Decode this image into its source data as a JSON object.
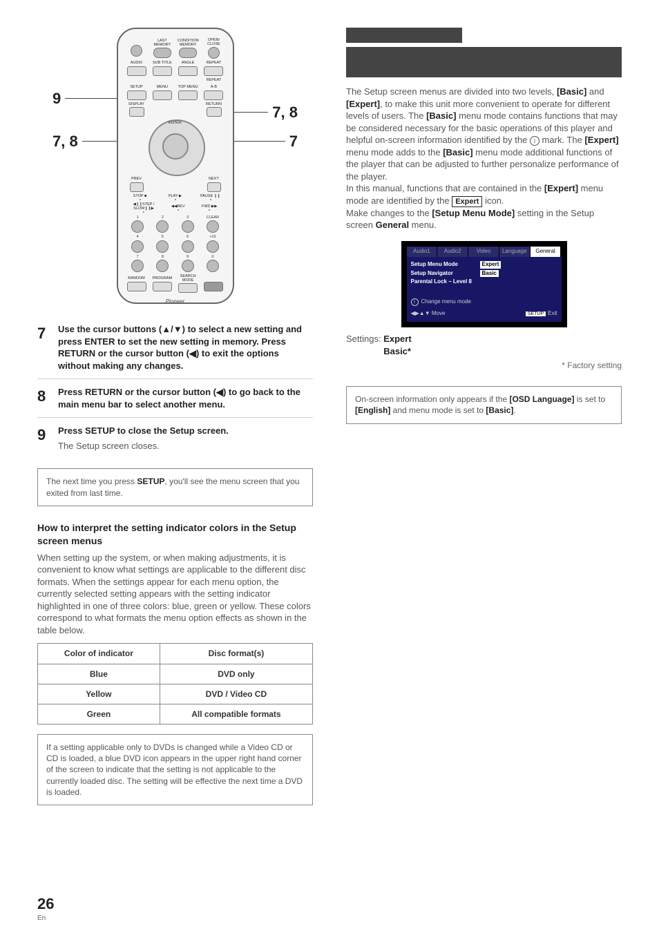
{
  "pageNumber": "26",
  "pageLang": "En",
  "remote": {
    "row1": [
      "",
      "LAST MEMORY",
      "CONDITION MEMORY",
      "OPEN/ CLOSE"
    ],
    "row2": [
      "AUDIO",
      "SUB TITLE",
      "ANGLE",
      "REPEAT"
    ],
    "row2b": "REPEAT",
    "row3": [
      "SETUP",
      "MENU",
      "TOP MENU",
      "A-B"
    ],
    "row4_left": "DISPLAY",
    "row4_right": "RETURN",
    "enter": "ENTER",
    "prev": "PREV",
    "next": "NEXT",
    "playRow": [
      "STOP ■",
      "PLAY ▶",
      "PAUSE ❙❙"
    ],
    "stepRow": [
      "◀❙❙STEP / SLOW❙❙▶",
      "◀◀REV",
      "FWD ▶▶"
    ],
    "numTop": [
      "1",
      "2",
      "3",
      "CLEAR",
      "4",
      "5",
      "6",
      "+10",
      "7",
      "8",
      "9",
      "0"
    ],
    "bottomRow": [
      "RANDOM",
      "PROGRAM",
      "SEARCH MODE",
      ""
    ],
    "brand": "Pioneer"
  },
  "callouts": {
    "c9": "9",
    "c78l": "7, 8",
    "c78r": "7, 8",
    "c7r": "7"
  },
  "steps": [
    {
      "num": "7",
      "title_parts": [
        "Use the cursor buttons (",
        "▲",
        "/",
        "▼",
        ") to select a new  setting and press ENTER to set the new setting in memory. Press RETURN or the cursor button (",
        "◀",
        ") to exit the options without making any changes."
      ],
      "note": ""
    },
    {
      "num": "8",
      "title_parts": [
        "Press RETURN or the cursor button (",
        "◀",
        ") to go back to the main menu bar to select another menu."
      ],
      "note": ""
    },
    {
      "num": "9",
      "title_parts": [
        "Press SETUP to close the Setup screen."
      ],
      "note": "The Setup screen closes."
    }
  ],
  "tipBox": {
    "pre": "The next time you press ",
    "bold": "SETUP",
    "post": ", you'll see the menu screen that you exited from last time."
  },
  "subHeading": "How to interpret the setting indicator colors in the Setup screen menus",
  "subBody": "When setting up the system, or when making adjustments, it is convenient to know what settings are applicable to the different disc formats. When the settings appear for each menu option, the currently selected setting appears with the setting indicator highlighted in one of three colors: blue, green or yellow. These colors correspond to what formats the menu option effects as shown in the table below.",
  "table": {
    "headers": [
      "Color of indicator",
      "Disc format(s)"
    ],
    "rows": [
      [
        "Blue",
        "DVD only"
      ],
      [
        "Yellow",
        "DVD / Video CD"
      ],
      [
        "Green",
        "All compatible formats"
      ]
    ]
  },
  "leftNoteBox": "If a setting applicable only to DVDs is changed while a Video CD or CD is loaded, a blue DVD icon appears in the upper right hand corner of the screen to indicate that the setting is not applicable to the currently loaded disc. The setting will be effective the next time a DVD is loaded.",
  "rightPara1": {
    "pieces": [
      {
        "t": "The Setup screen menus are divided into two levels, "
      },
      {
        "t": "[Basic]",
        "b": true
      },
      {
        "t": " and "
      },
      {
        "t": "[Expert]",
        "b": true
      },
      {
        "t": ", to make this unit more convenient to operate for different levels of users. The "
      },
      {
        "t": "[Basic]",
        "b": true
      },
      {
        "t": " menu mode contains functions that may be considered necessary for the basic operations of this player and helpful on-screen information identified by the "
      },
      {
        "icon": "i"
      },
      {
        "t": " mark. The "
      },
      {
        "t": "[Expert]",
        "b": true
      },
      {
        "t": " menu mode adds to the "
      },
      {
        "t": "[Basic]",
        "b": true
      },
      {
        "t": " menu mode additional functions of the player that can be adjusted to further personalize performance of the player."
      }
    ]
  },
  "rightPara2": {
    "pieces": [
      {
        "t": "In this manual, functions that are contained in the "
      },
      {
        "t": "[Expert]",
        "b": true
      },
      {
        "t": " menu mode are identified by the "
      },
      {
        "tag": "Expert"
      },
      {
        "t": " icon."
      }
    ]
  },
  "rightPara3": {
    "pieces": [
      {
        "t": "Make changes to the "
      },
      {
        "t": "[Setup Menu Mode]",
        "b": true
      },
      {
        "t": " setting in the Setup screen "
      },
      {
        "t": "General",
        "b": true
      },
      {
        "t": " menu."
      }
    ]
  },
  "osd": {
    "tabs": [
      "Audio1",
      "Audio2",
      "Video",
      "Language",
      "General"
    ],
    "activeTab": 4,
    "lines": [
      {
        "k": "Setup Menu Mode",
        "v": "Expert",
        "box": true
      },
      {
        "k": "Setup Navigator",
        "v": "Basic",
        "box": true
      },
      {
        "k": "Parental Lock – Level 8",
        "v": ""
      }
    ],
    "hint": "Change menu mode",
    "footerMove": "Move",
    "footerArrows": "◀▶▲▼",
    "footerSetup": "SETUP",
    "footerExit": "Exit"
  },
  "settingsLabel": "Settings:",
  "settingsValues": [
    "Expert",
    "Basic*"
  ],
  "factoryNote": "* Factory setting",
  "rightNoteBox": {
    "pieces": [
      {
        "t": "On-screen information only appears if the "
      },
      {
        "t": "[OSD Language]",
        "b": true
      },
      {
        "t": " is set to "
      },
      {
        "t": "[English]",
        "b": true
      },
      {
        "t": " and menu mode is set to "
      },
      {
        "t": "[Basic]",
        "b": true
      },
      {
        "t": "."
      }
    ]
  }
}
